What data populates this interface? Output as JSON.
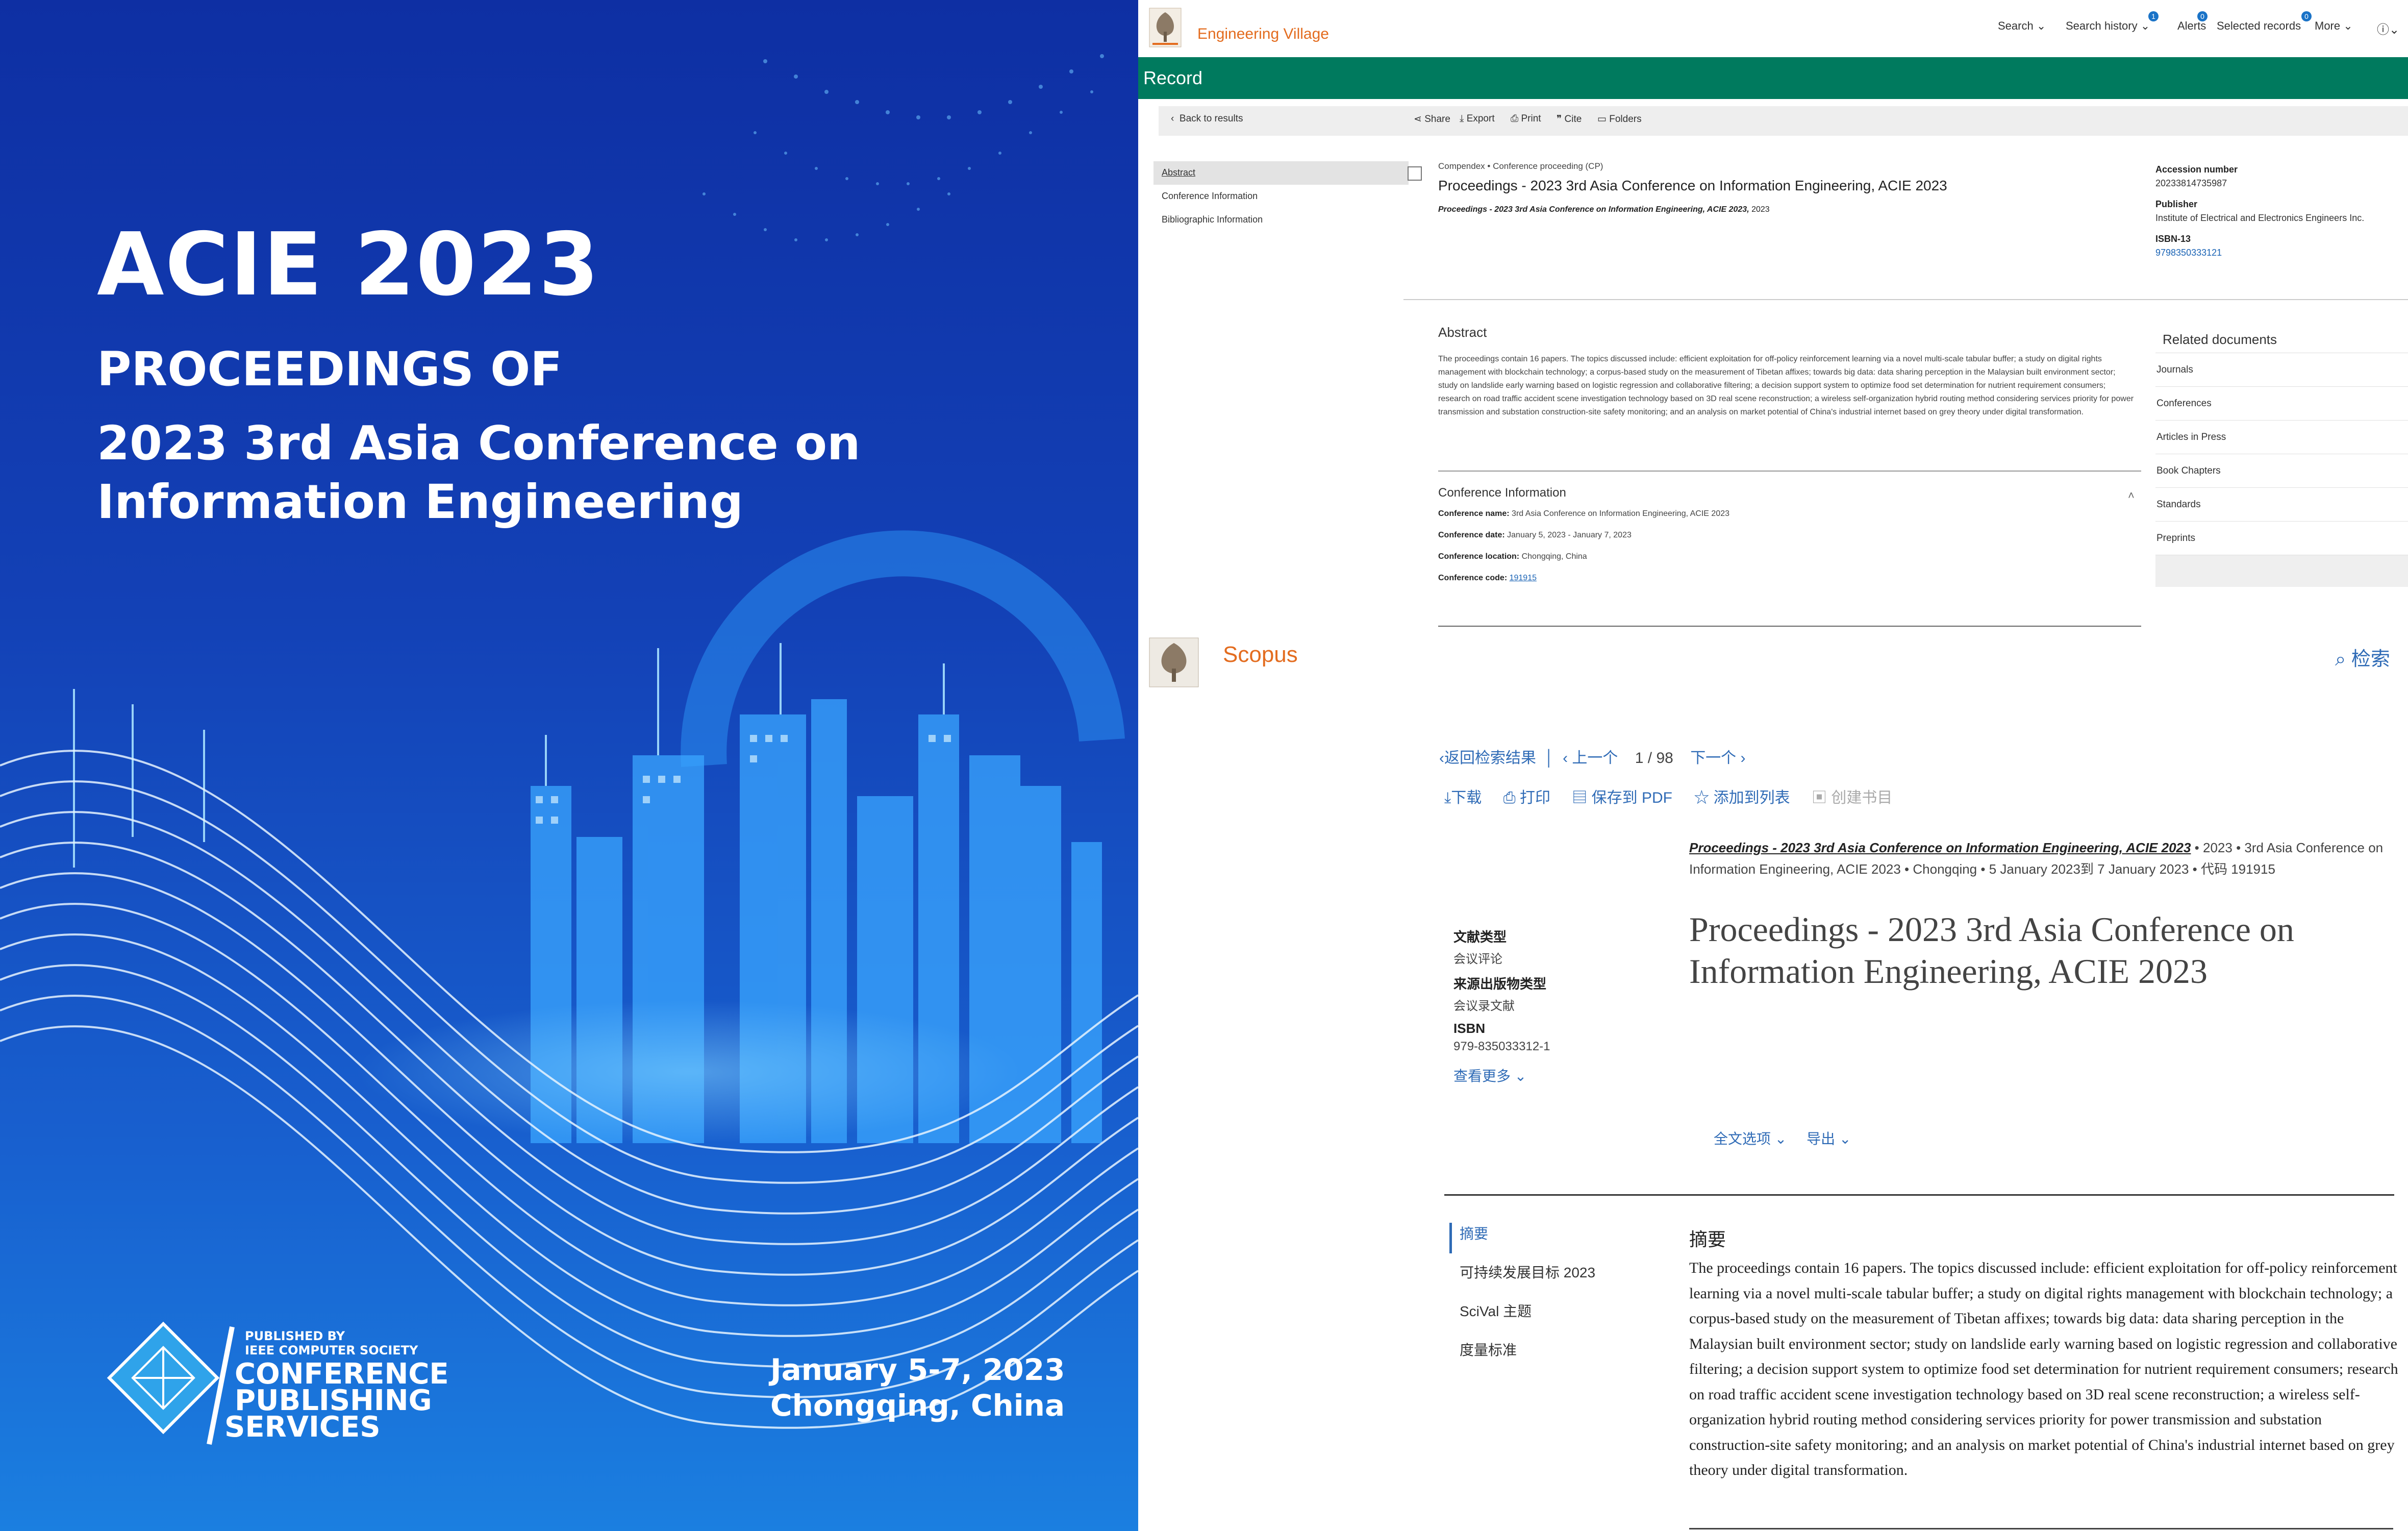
{
  "cover": {
    "title": "ACIE 2023",
    "pre": "PROCEEDINGS OF",
    "conf_line1": "2023 3rd Asia Conference on",
    "conf_line2": "Information Engineering",
    "date": "January 5-7, 2023",
    "place": "Chongqing, China",
    "cps_small1": "PUBLISHED BY",
    "cps_small2": "IEEE COMPUTER SOCIETY",
    "cps_big1": "CONFERENCE",
    "cps_big2": "PUBLISHING",
    "cps_big3": "SERVICES"
  },
  "ev": {
    "brand": "Engineering Village",
    "nav": [
      "Search",
      "Search history",
      "Alerts",
      "Selected records",
      "More"
    ],
    "badges": [
      "1",
      "0",
      "0"
    ],
    "record_title": "Record",
    "back": "Back to results",
    "tools": [
      "Share",
      "Export",
      "Print",
      "Cite",
      "Folders"
    ],
    "sidebar": [
      "Abstract",
      "Conference Information",
      "Bibliographic Information"
    ],
    "doc_type": "Compendex  •  Conference proceeding (CP)",
    "doc_title": "Proceedings - 2023 3rd Asia Conference on Information Engineering, ACIE 2023",
    "doc_source": "Proceedings - 2023 3rd Asia Conference on Information Engineering, ACIE 2023,",
    "doc_year": "2023",
    "accession_label": "Accession number",
    "accession": "20233814735987",
    "publisher_label": "Publisher",
    "publisher": "Institute of Electrical and Electronics Engineers Inc.",
    "isbn_label": "ISBN-13",
    "isbn": "9798350333121",
    "abstract_head": "Abstract",
    "abstract": "The proceedings contain 16 papers. The topics discussed include: efficient exploitation for off-policy reinforcement learning via a novel multi-scale tabular buffer; a study on digital rights management with blockchain technology; a corpus-based study on the measurement of Tibetan affixes; towards big data: data sharing perception in the Malaysian built environment sector; study on landslide early warning based on logistic regression and collaborative filtering; a decision support system to optimize food set determination for nutrient requirement consumers; research on road traffic accident scene investigation technology based on 3D real scene reconstruction; a wireless self-organization hybrid routing method considering services priority for power transmission and substation construction-site safety monitoring; and an analysis on market potential of China's industrial internet based on grey theory under digital transformation.",
    "related_head": "Related documents",
    "related": [
      "Journals",
      "Conferences",
      "Articles in Press",
      "Book Chapters",
      "Standards",
      "Preprints"
    ],
    "conf_head": "Conference Information",
    "conf_name_label": "Conference name:",
    "conf_name": "3rd Asia Conference on Information Engineering, ACIE 2023",
    "conf_date_label": "Conference date:",
    "conf_date": "January 5, 2023 - January 7, 2023",
    "conf_loc_label": "Conference location:",
    "conf_loc": "Chongqing, China",
    "conf_code_label": "Conference code:",
    "conf_code": "191915"
  },
  "scopus": {
    "brand": "Scopus",
    "search": "检索",
    "back": "返回检索结果",
    "prev": "上一个",
    "page": "1",
    "total": "98",
    "next": "下一个",
    "actions": [
      "下载",
      "打印",
      "保存到 PDF",
      "添加到列表",
      "创建书目"
    ],
    "source_title": "Proceedings - 2023 3rd Asia Conference on Information Engineering, ACIE 2023",
    "source_rest": " • 2023 • 3rd Asia Conference on Information Engineering, ACIE 2023 • Chongqing • 5 January 2023到 7 January 2023 • 代码 191915",
    "doc_type_label": "文献类型",
    "doc_type": "会议评论",
    "source_type_label": "来源出版物类型",
    "source_type": "会议录文献",
    "isbn_label": "ISBN",
    "isbn": "979-835033312-1",
    "more": "查看更多",
    "title": "Proceedings - 2023 3rd Asia Conference on Information Engineering, ACIE 2023",
    "fulltext": "全文选项",
    "export": "导出",
    "tabs": [
      "摘要",
      "可持续发展目标 2023",
      "SciVal 主题",
      "度量标准"
    ],
    "abstract_head": "摘要",
    "abstract": "The proceedings contain 16 papers. The topics discussed include: efficient exploitation for off-policy reinforcement learning via a novel multi-scale tabular buffer; a study on digital rights management with blockchain technology; a corpus-based study on the measurement of Tibetan affixes; towards big data: data sharing perception in the Malaysian built environment sector; study on landslide early warning based on logistic regression and collaborative filtering; a decision support system to optimize food set determination for nutrient requirement consumers; research on road traffic accident scene investigation technology based on 3D real scene reconstruction; a wireless self-organization hybrid routing method considering services priority for power transmission and substation construction-site safety monitoring; and an analysis on market potential of China's industrial internet based on grey theory under digital transformation."
  },
  "colors": {
    "ev_green": "#007a5e",
    "ev_orange": "#e36c1f",
    "scopus_blue": "#2f6bb6",
    "cover_blue": "#1341b6"
  }
}
